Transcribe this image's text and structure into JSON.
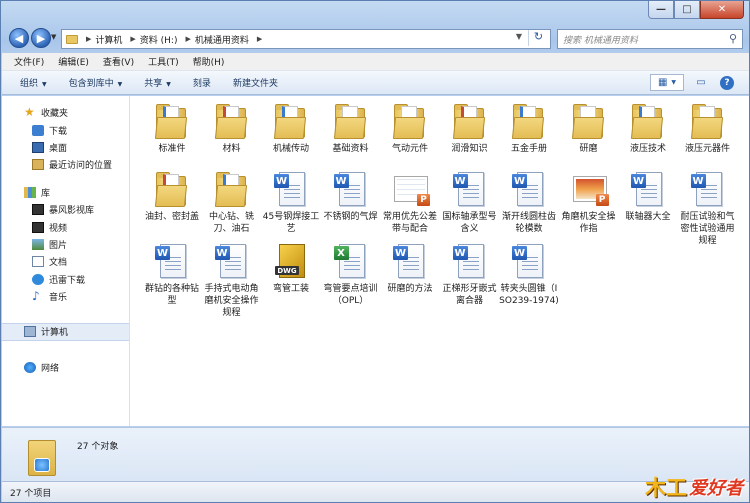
{
  "window": {
    "caption_buttons": {
      "minimize": "—",
      "maximize": "□",
      "close": "✕"
    }
  },
  "address": {
    "back_icon": "back-arrow-icon",
    "forward_icon": "forward-arrow-icon",
    "breadcrumbs": [
      "计算机",
      "资料 (H:)",
      "机械通用资料"
    ],
    "search_placeholder": "搜索 机械通用资料"
  },
  "menu": [
    "文件(F)",
    "编辑(E)",
    "查看(V)",
    "工具(T)",
    "帮助(H)"
  ],
  "toolbar": {
    "organize": "组织",
    "include_library": "包含到库中",
    "share": "共享",
    "burn": "刻录",
    "new_folder": "新建文件夹"
  },
  "sidebar": {
    "favorites_header": "收藏夹",
    "favorites": [
      "下载",
      "桌面",
      "最近访问的位置"
    ],
    "library_header": "库",
    "libraries": [
      "暴风影视库",
      "视频",
      "图片",
      "文档",
      "迅雷下载",
      "音乐"
    ],
    "computer": "计算机",
    "network": "网络"
  },
  "files": [
    {
      "name": "标准件",
      "type": "folder",
      "paper": "blue"
    },
    {
      "name": "材料",
      "type": "folder",
      "paper": "red"
    },
    {
      "name": "机械传动",
      "type": "folder",
      "paper": "blue"
    },
    {
      "name": "基础资料",
      "type": "folder",
      "paper": "plain"
    },
    {
      "name": "气动元件",
      "type": "folder",
      "paper": "plain"
    },
    {
      "name": "润滑知识",
      "type": "folder",
      "paper": "red"
    },
    {
      "name": "五金手册",
      "type": "folder",
      "paper": "blue"
    },
    {
      "name": "研磨",
      "type": "folder",
      "paper": "plain"
    },
    {
      "name": "液压技术",
      "type": "folder",
      "paper": "blue"
    },
    {
      "name": "液压元器件",
      "type": "folder",
      "paper": "plain"
    },
    {
      "name": "油封、密封盖",
      "type": "folder",
      "paper": "red"
    },
    {
      "name": "中心钻、铣刀、油石",
      "type": "folder",
      "paper": "blue"
    },
    {
      "name": "45号钢焊接工艺",
      "type": "word"
    },
    {
      "name": "不锈钢的气焊",
      "type": "word"
    },
    {
      "name": "常用优先公差带与配合",
      "type": "ppt-table"
    },
    {
      "name": "国标轴承型号含义",
      "type": "word"
    },
    {
      "name": "渐开线圆柱齿轮模数",
      "type": "word"
    },
    {
      "name": "角磨机安全操作指",
      "type": "ppt-photo"
    },
    {
      "name": "联轴器大全",
      "type": "word"
    },
    {
      "name": "耐压试验和气密性试验通用规程",
      "type": "word"
    },
    {
      "name": "群钻的各种钻型",
      "type": "word"
    },
    {
      "name": "手持式电动角磨机安全操作规程",
      "type": "word"
    },
    {
      "name": "弯管工装",
      "type": "dwg"
    },
    {
      "name": "弯管要点培训（OPL）",
      "type": "excel"
    },
    {
      "name": "研磨的方法",
      "type": "word"
    },
    {
      "name": "正梯形牙嵌式离合器",
      "type": "word"
    },
    {
      "name": "转夹头圆锥（ISO239-1974)",
      "type": "word"
    }
  ],
  "details": {
    "count_text": "27 个对象"
  },
  "status": {
    "text": "27 个项目"
  },
  "watermark": {
    "mark": "木工",
    "text": "爱好者"
  }
}
